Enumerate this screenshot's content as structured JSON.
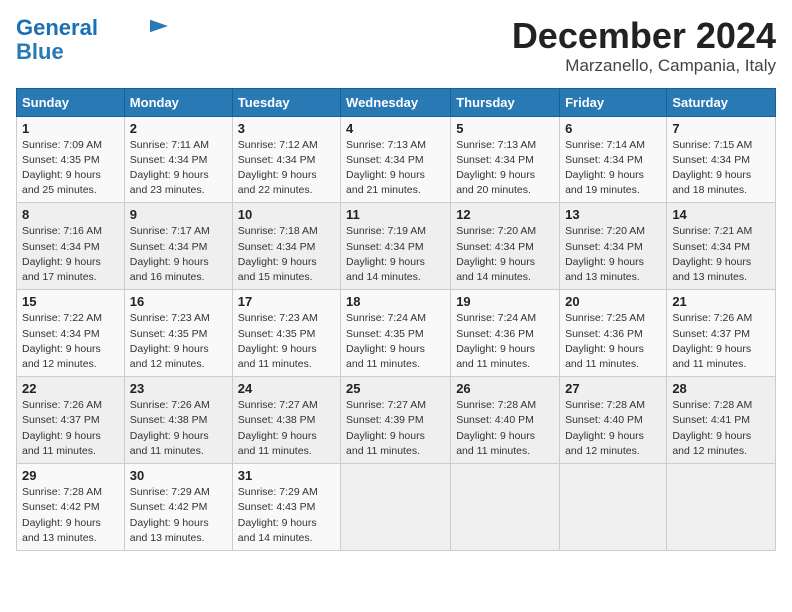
{
  "logo": {
    "line1": "General",
    "line2": "Blue"
  },
  "title": "December 2024",
  "subtitle": "Marzanello, Campania, Italy",
  "days_of_week": [
    "Sunday",
    "Monday",
    "Tuesday",
    "Wednesday",
    "Thursday",
    "Friday",
    "Saturday"
  ],
  "weeks": [
    [
      {
        "day": "1",
        "info": "Sunrise: 7:09 AM\nSunset: 4:35 PM\nDaylight: 9 hours\nand 25 minutes."
      },
      {
        "day": "2",
        "info": "Sunrise: 7:11 AM\nSunset: 4:34 PM\nDaylight: 9 hours\nand 23 minutes."
      },
      {
        "day": "3",
        "info": "Sunrise: 7:12 AM\nSunset: 4:34 PM\nDaylight: 9 hours\nand 22 minutes."
      },
      {
        "day": "4",
        "info": "Sunrise: 7:13 AM\nSunset: 4:34 PM\nDaylight: 9 hours\nand 21 minutes."
      },
      {
        "day": "5",
        "info": "Sunrise: 7:13 AM\nSunset: 4:34 PM\nDaylight: 9 hours\nand 20 minutes."
      },
      {
        "day": "6",
        "info": "Sunrise: 7:14 AM\nSunset: 4:34 PM\nDaylight: 9 hours\nand 19 minutes."
      },
      {
        "day": "7",
        "info": "Sunrise: 7:15 AM\nSunset: 4:34 PM\nDaylight: 9 hours\nand 18 minutes."
      }
    ],
    [
      {
        "day": "8",
        "info": "Sunrise: 7:16 AM\nSunset: 4:34 PM\nDaylight: 9 hours\nand 17 minutes."
      },
      {
        "day": "9",
        "info": "Sunrise: 7:17 AM\nSunset: 4:34 PM\nDaylight: 9 hours\nand 16 minutes."
      },
      {
        "day": "10",
        "info": "Sunrise: 7:18 AM\nSunset: 4:34 PM\nDaylight: 9 hours\nand 15 minutes."
      },
      {
        "day": "11",
        "info": "Sunrise: 7:19 AM\nSunset: 4:34 PM\nDaylight: 9 hours\nand 14 minutes."
      },
      {
        "day": "12",
        "info": "Sunrise: 7:20 AM\nSunset: 4:34 PM\nDaylight: 9 hours\nand 14 minutes."
      },
      {
        "day": "13",
        "info": "Sunrise: 7:20 AM\nSunset: 4:34 PM\nDaylight: 9 hours\nand 13 minutes."
      },
      {
        "day": "14",
        "info": "Sunrise: 7:21 AM\nSunset: 4:34 PM\nDaylight: 9 hours\nand 13 minutes."
      }
    ],
    [
      {
        "day": "15",
        "info": "Sunrise: 7:22 AM\nSunset: 4:34 PM\nDaylight: 9 hours\nand 12 minutes."
      },
      {
        "day": "16",
        "info": "Sunrise: 7:23 AM\nSunset: 4:35 PM\nDaylight: 9 hours\nand 12 minutes."
      },
      {
        "day": "17",
        "info": "Sunrise: 7:23 AM\nSunset: 4:35 PM\nDaylight: 9 hours\nand 11 minutes."
      },
      {
        "day": "18",
        "info": "Sunrise: 7:24 AM\nSunset: 4:35 PM\nDaylight: 9 hours\nand 11 minutes."
      },
      {
        "day": "19",
        "info": "Sunrise: 7:24 AM\nSunset: 4:36 PM\nDaylight: 9 hours\nand 11 minutes."
      },
      {
        "day": "20",
        "info": "Sunrise: 7:25 AM\nSunset: 4:36 PM\nDaylight: 9 hours\nand 11 minutes."
      },
      {
        "day": "21",
        "info": "Sunrise: 7:26 AM\nSunset: 4:37 PM\nDaylight: 9 hours\nand 11 minutes."
      }
    ],
    [
      {
        "day": "22",
        "info": "Sunrise: 7:26 AM\nSunset: 4:37 PM\nDaylight: 9 hours\nand 11 minutes."
      },
      {
        "day": "23",
        "info": "Sunrise: 7:26 AM\nSunset: 4:38 PM\nDaylight: 9 hours\nand 11 minutes."
      },
      {
        "day": "24",
        "info": "Sunrise: 7:27 AM\nSunset: 4:38 PM\nDaylight: 9 hours\nand 11 minutes."
      },
      {
        "day": "25",
        "info": "Sunrise: 7:27 AM\nSunset: 4:39 PM\nDaylight: 9 hours\nand 11 minutes."
      },
      {
        "day": "26",
        "info": "Sunrise: 7:28 AM\nSunset: 4:40 PM\nDaylight: 9 hours\nand 11 minutes."
      },
      {
        "day": "27",
        "info": "Sunrise: 7:28 AM\nSunset: 4:40 PM\nDaylight: 9 hours\nand 12 minutes."
      },
      {
        "day": "28",
        "info": "Sunrise: 7:28 AM\nSunset: 4:41 PM\nDaylight: 9 hours\nand 12 minutes."
      }
    ],
    [
      {
        "day": "29",
        "info": "Sunrise: 7:28 AM\nSunset: 4:42 PM\nDaylight: 9 hours\nand 13 minutes."
      },
      {
        "day": "30",
        "info": "Sunrise: 7:29 AM\nSunset: 4:42 PM\nDaylight: 9 hours\nand 13 minutes."
      },
      {
        "day": "31",
        "info": "Sunrise: 7:29 AM\nSunset: 4:43 PM\nDaylight: 9 hours\nand 14 minutes."
      },
      null,
      null,
      null,
      null
    ]
  ]
}
